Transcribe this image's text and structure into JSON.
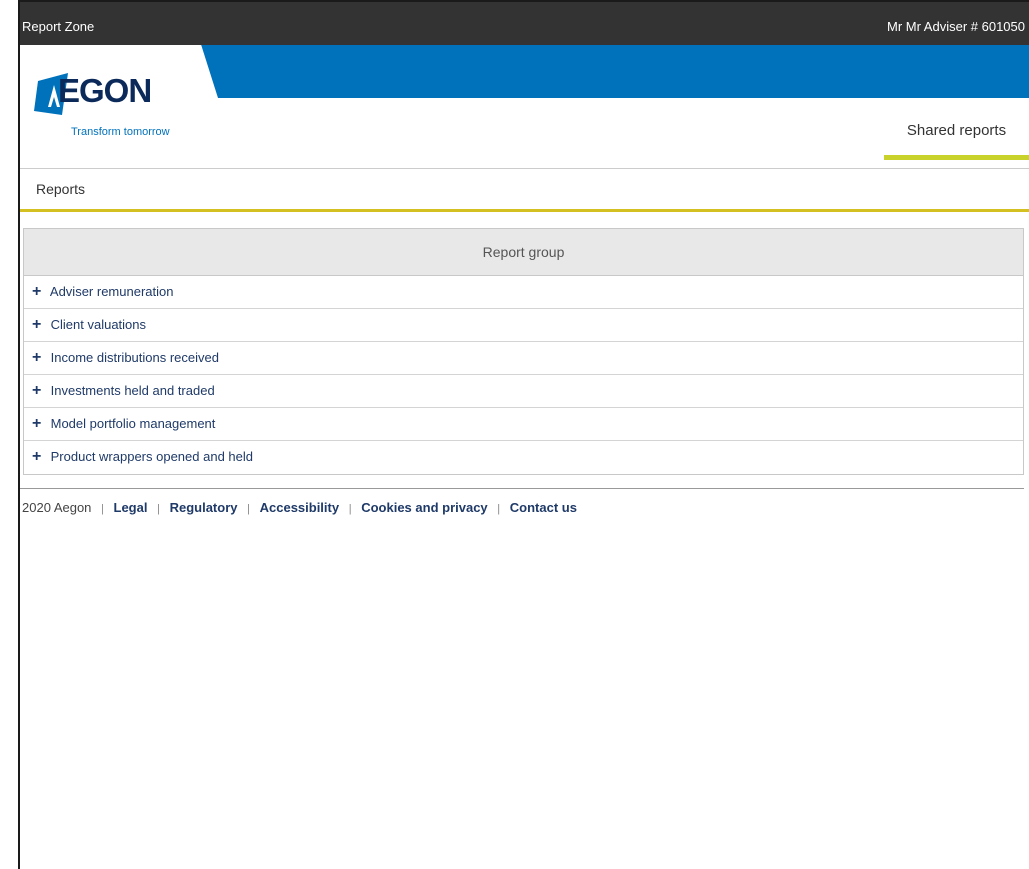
{
  "topbar": {
    "app_title": "Report Zone",
    "user_info": "Mr Mr Adviser # 601050"
  },
  "header": {
    "logo_text": "EGON",
    "tagline": "Transform tomorrow",
    "nav_tab": "Shared reports"
  },
  "breadcrumb": {
    "current": "Reports"
  },
  "report_group": {
    "header": "Report group",
    "items": [
      {
        "label": "Adviser remuneration"
      },
      {
        "label": "Client valuations"
      },
      {
        "label": "Income distributions received"
      },
      {
        "label": "Investments held and traded"
      },
      {
        "label": "Model portfolio management"
      },
      {
        "label": "Product wrappers opened and held"
      }
    ],
    "expand_glyph": "+"
  },
  "footer": {
    "copyright": "2020 Aegon",
    "separator": "|",
    "links": [
      "Legal",
      "Regulatory",
      "Accessibility",
      "Cookies and privacy",
      "Contact us"
    ]
  },
  "colors": {
    "topbar": "#333333",
    "brand_blue": "#0072bc",
    "brand_navy": "#0b2a5a",
    "accent_lime": "#c8d22a",
    "accent_gold": "#d4c021",
    "link": "#1f3a68"
  }
}
